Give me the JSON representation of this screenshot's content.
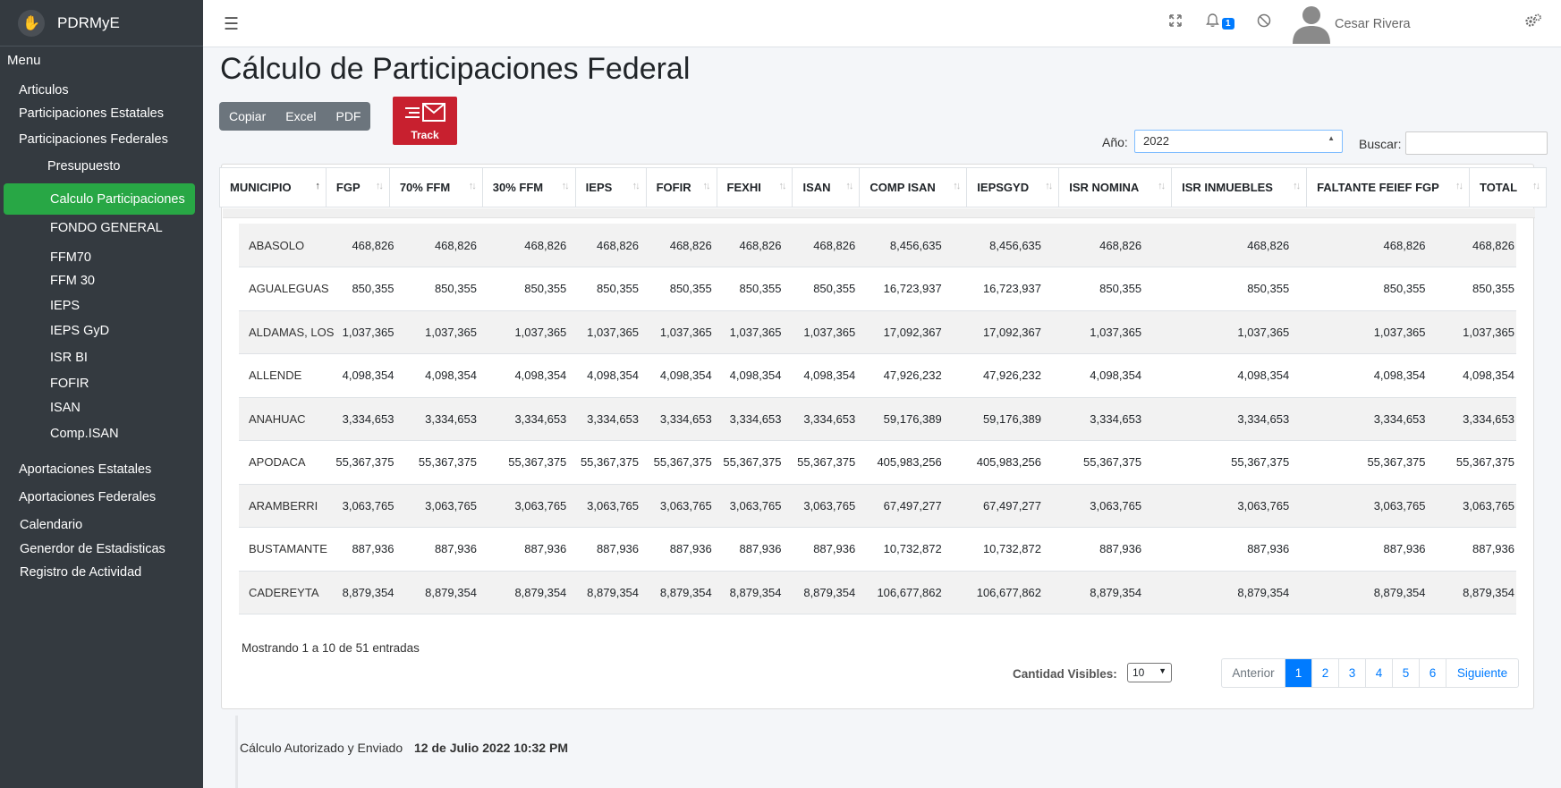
{
  "app": {
    "brand": "PDRMyE"
  },
  "sidebar": {
    "menu_title": "Menu",
    "items": [
      {
        "label": "Articulos"
      },
      {
        "label": "Participaciones Estatales"
      },
      {
        "label": "Participaciones Federales"
      },
      {
        "label": "Presupuesto"
      },
      {
        "label": "Calculo Participaciones"
      },
      {
        "label": "FONDO GENERAL"
      },
      {
        "label": "FFM70"
      },
      {
        "label": "FFM 30"
      },
      {
        "label": "IEPS"
      },
      {
        "label": "IEPS GyD"
      },
      {
        "label": "ISR BI"
      },
      {
        "label": "FOFIR"
      },
      {
        "label": "ISAN"
      },
      {
        "label": "Comp.ISAN"
      },
      {
        "label": "Aportaciones Estatales"
      },
      {
        "label": "Aportaciones Federales"
      },
      {
        "label": "Calendario"
      },
      {
        "label": "Generdor de Estadisticas"
      },
      {
        "label": "Registro de Actividad"
      }
    ]
  },
  "topbar": {
    "notification_count": "1",
    "user_name": "Cesar Rivera",
    "icons": [
      "menu-icon",
      "expand-icon",
      "bell-icon",
      "block-icon",
      "user-icon",
      "settings-icon"
    ]
  },
  "page": {
    "title": "Cálculo de Participaciones Federal",
    "export_buttons": {
      "copy": "Copiar",
      "excel": "Excel",
      "pdf": "PDF"
    },
    "track_label": "Track",
    "year_label": "Año:",
    "year_value": "2022",
    "search_label": "Buscar:"
  },
  "table": {
    "columns": [
      "MUNICIPIO",
      "FGP",
      "70% FFM",
      "30% FFM",
      "IEPS",
      "FOFIR",
      "FEXHI",
      "ISAN",
      "COMP ISAN",
      "IEPSGYD",
      "ISR NOMINA",
      "ISR INMUEBLES",
      "FALTANTE FEIEF FGP",
      "TOTAL"
    ],
    "rows": [
      [
        "ABASOLO",
        "468,826",
        "468,826",
        "468,826",
        "468,826",
        "468,826",
        "468,826",
        "468,826",
        "8,456,635",
        "8,456,635",
        "468,826",
        "468,826",
        "468,826",
        "468,826"
      ],
      [
        "AGUALEGUAS",
        "850,355",
        "850,355",
        "850,355",
        "850,355",
        "850,355",
        "850,355",
        "850,355",
        "16,723,937",
        "16,723,937",
        "850,355",
        "850,355",
        "850,355",
        "850,355"
      ],
      [
        "ALDAMAS, LOS",
        "1,037,365",
        "1,037,365",
        "1,037,365",
        "1,037,365",
        "1,037,365",
        "1,037,365",
        "1,037,365",
        "17,092,367",
        "17,092,367",
        "1,037,365",
        "1,037,365",
        "1,037,365",
        "1,037,365"
      ],
      [
        "ALLENDE",
        "4,098,354",
        "4,098,354",
        "4,098,354",
        "4,098,354",
        "4,098,354",
        "4,098,354",
        "4,098,354",
        "47,926,232",
        "47,926,232",
        "4,098,354",
        "4,098,354",
        "4,098,354",
        "4,098,354"
      ],
      [
        "ANAHUAC",
        "3,334,653",
        "3,334,653",
        "3,334,653",
        "3,334,653",
        "3,334,653",
        "3,334,653",
        "3,334,653",
        "59,176,389",
        "59,176,389",
        "3,334,653",
        "3,334,653",
        "3,334,653",
        "3,334,653"
      ],
      [
        "APODACA",
        "55,367,375",
        "55,367,375",
        "55,367,375",
        "55,367,375",
        "55,367,375",
        "55,367,375",
        "55,367,375",
        "405,983,256",
        "405,983,256",
        "55,367,375",
        "55,367,375",
        "55,367,375",
        "55,367,375"
      ],
      [
        "ARAMBERRI",
        "3,063,765",
        "3,063,765",
        "3,063,765",
        "3,063,765",
        "3,063,765",
        "3,063,765",
        "3,063,765",
        "67,497,277",
        "67,497,277",
        "3,063,765",
        "3,063,765",
        "3,063,765",
        "3,063,765"
      ],
      [
        "BUSTAMANTE",
        "887,936",
        "887,936",
        "887,936",
        "887,936",
        "887,936",
        "887,936",
        "887,936",
        "10,732,872",
        "10,732,872",
        "887,936",
        "887,936",
        "887,936",
        "887,936"
      ],
      [
        "CADEREYTA",
        "8,879,354",
        "8,879,354",
        "8,879,354",
        "8,879,354",
        "8,879,354",
        "8,879,354",
        "8,879,354",
        "106,677,862",
        "106,677,862",
        "8,879,354",
        "8,879,354",
        "8,879,354",
        "8,879,354"
      ]
    ],
    "showing_text": "Mostrando 1 a 10 de 51 entradas",
    "visible_label": "Cantidad Visibles:",
    "visible_value": "10",
    "pagination": {
      "prev": "Anterior",
      "pages": [
        "1",
        "2",
        "3",
        "4",
        "5",
        "6"
      ],
      "next": "Siguiente",
      "current": "1"
    }
  },
  "footer": {
    "label": "Cálculo Autorizado y Enviado",
    "date": "12 de Julio 2022 10:32 PM"
  },
  "colors": {
    "sidebar": "#343a40",
    "active": "#28a745",
    "primary": "#007bff",
    "track": "#c8202f"
  }
}
